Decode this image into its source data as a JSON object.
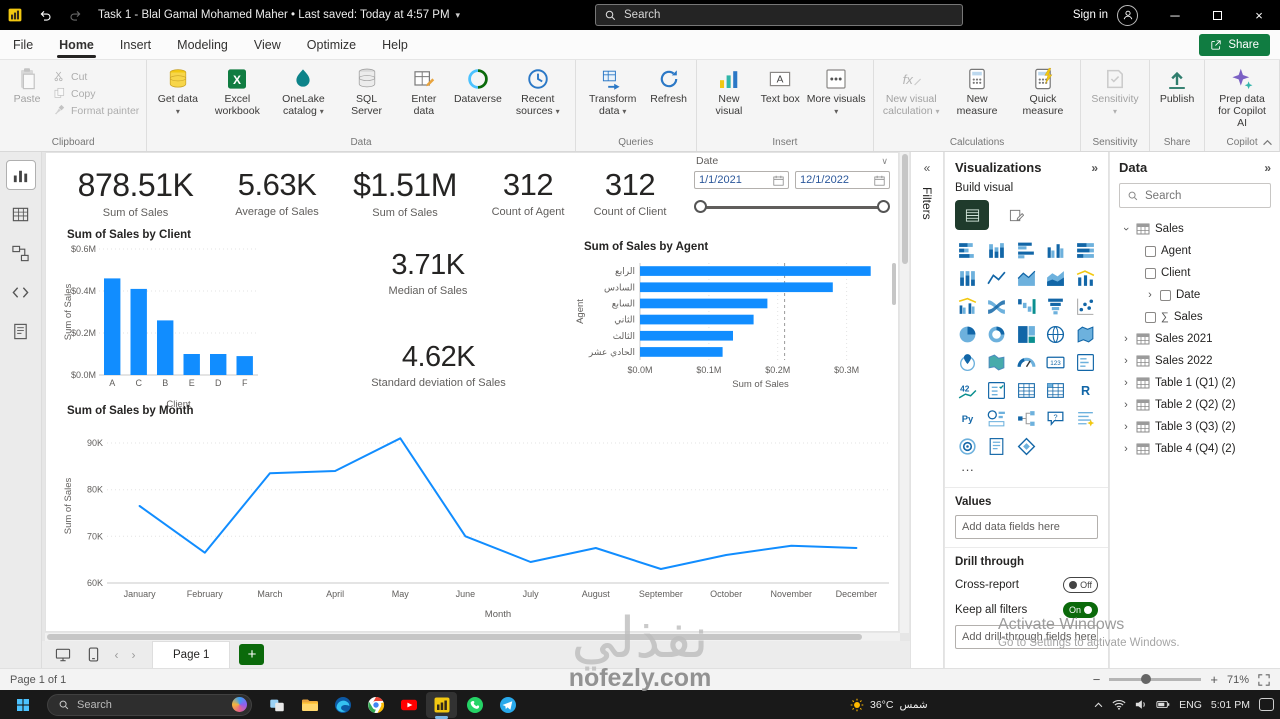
{
  "colors": {
    "accent_blue": "#118DFF",
    "share_green": "#107C41",
    "toggle_on_green": "#0B6A0B",
    "taskbar_black": "#191919"
  },
  "titlebar": {
    "title": "Task 1 - Blal Gamal Mohamed Maher  •  Last saved: Today at 4:57 PM",
    "search_placeholder": "Search",
    "sign_in": "Sign in"
  },
  "menu": {
    "items": [
      "File",
      "Home",
      "Insert",
      "Modeling",
      "View",
      "Optimize",
      "Help"
    ],
    "active_index": 1,
    "share_label": "Share"
  },
  "ribbon": {
    "groups": [
      {
        "label": "Clipboard",
        "layout": "clipboard",
        "items": [
          {
            "label": "Paste",
            "icon": "paste",
            "disabled": true,
            "big": true
          },
          {
            "label": "Cut",
            "icon": "cut",
            "disabled": true
          },
          {
            "label": "Copy",
            "icon": "copy",
            "disabled": true
          },
          {
            "label": "Format painter",
            "icon": "brush",
            "disabled": true
          }
        ]
      },
      {
        "label": "Data",
        "items": [
          {
            "label": "Get data",
            "icon": "getdata",
            "dropdown": true
          },
          {
            "label": "Excel workbook",
            "icon": "excel"
          },
          {
            "label": "OneLake catalog",
            "icon": "onelake",
            "dropdown": true
          },
          {
            "label": "SQL Server",
            "icon": "sql"
          },
          {
            "label": "Enter data",
            "icon": "enter"
          },
          {
            "label": "Dataverse",
            "icon": "dataverse"
          },
          {
            "label": "Recent sources",
            "icon": "recent",
            "dropdown": true
          }
        ]
      },
      {
        "label": "Queries",
        "items": [
          {
            "label": "Transform data",
            "icon": "transform",
            "dropdown": true
          },
          {
            "label": "Refresh",
            "icon": "refresh"
          }
        ]
      },
      {
        "label": "Insert",
        "items": [
          {
            "label": "New visual",
            "icon": "newvisual"
          },
          {
            "label": "Text box",
            "icon": "textbox"
          },
          {
            "label": "More visuals",
            "icon": "morevisuals",
            "dropdown": true
          }
        ]
      },
      {
        "label": "Calculations",
        "items": [
          {
            "label": "New visual calculation",
            "icon": "fx",
            "disabled": true,
            "dropdown": true
          },
          {
            "label": "New measure",
            "icon": "measure"
          },
          {
            "label": "Quick measure",
            "icon": "quickmeasure"
          }
        ]
      },
      {
        "label": "Sensitivity",
        "items": [
          {
            "label": "Sensitivity",
            "icon": "sensitivity",
            "disabled": true,
            "dropdown": true
          }
        ]
      },
      {
        "label": "Share",
        "items": [
          {
            "label": "Publish",
            "icon": "publish"
          }
        ]
      },
      {
        "label": "Copilot",
        "items": [
          {
            "label": "Prep data for Copilot AI",
            "icon": "copilot"
          }
        ]
      }
    ]
  },
  "view_strip": [
    "report-view",
    "table-view",
    "model-view",
    "dax-query-view",
    "tmdl-view"
  ],
  "canvas": {
    "cards": [
      {
        "value": "878.51K",
        "label": "Sum of Sales"
      },
      {
        "value": "5.63K",
        "label": "Average of Sales"
      },
      {
        "value": "$1.51M",
        "label": "Sum of Sales"
      },
      {
        "value": "312",
        "label": "Count of Agent"
      },
      {
        "value": "312",
        "label": "Count of Client"
      },
      {
        "value": "3.71K",
        "label": "Median of Sales"
      },
      {
        "value": "4.62K",
        "label": "Standard deviation of Sales"
      }
    ],
    "slicer": {
      "title": "Date",
      "start": "1/1/2021",
      "end": "12/1/2022"
    }
  },
  "chart_data": [
    {
      "id": "sales-by-client",
      "type": "bar",
      "title": "Sum of Sales by Client",
      "categories": [
        "A",
        "C",
        "B",
        "E",
        "D",
        "F"
      ],
      "values": [
        0.46,
        0.41,
        0.26,
        0.1,
        0.1,
        0.09
      ],
      "xlabel": "Client",
      "ylabel": "Sum of Sales",
      "ylim": [
        0,
        0.6
      ],
      "yticks": [
        "$0.0M",
        "$0.2M",
        "$0.4M",
        "$0.6M"
      ],
      "grid": true,
      "legend": "none"
    },
    {
      "id": "sales-by-agent",
      "type": "bar-horizontal",
      "title": "Sum of Sales by Agent",
      "categories": [
        "الرابع",
        "السادس",
        "السابع",
        "الثاني",
        "الثالث",
        "الحادي عشر"
      ],
      "values": [
        0.335,
        0.28,
        0.185,
        0.165,
        0.135,
        0.12
      ],
      "xlabel": "Sum of Sales",
      "ylabel": "Agent",
      "xlim": [
        0,
        0.35
      ],
      "xticks": [
        "$0.0M",
        "$0.1M",
        "$0.2M",
        "$0.3M"
      ],
      "reference_line": 0.21,
      "grid": true,
      "legend": "none"
    },
    {
      "id": "sales-by-month",
      "type": "line",
      "title": "Sum of Sales by Month",
      "categories": [
        "January",
        "February",
        "March",
        "April",
        "May",
        "June",
        "July",
        "August",
        "September",
        "October",
        "November",
        "December"
      ],
      "values": [
        76.5,
        66.5,
        83.5,
        84,
        91,
        70,
        64.5,
        67.5,
        63,
        66,
        68,
        67.5
      ],
      "unit": "K",
      "xlabel": "Month",
      "ylabel": "Sum of Sales",
      "ylim": [
        60,
        93
      ],
      "ytick_values": [
        60,
        70,
        80,
        90
      ],
      "yticks": [
        "60K",
        "70K",
        "80K",
        "90K"
      ],
      "grid": true,
      "legend": "none"
    }
  ],
  "filters_pane": {
    "title": "Filters"
  },
  "viz_pane": {
    "title": "Visualizations",
    "build_visual": "Build visual",
    "gallery": [
      "stacked-bar-chart",
      "stacked-column-chart",
      "clustered-bar-chart",
      "clustered-column-chart",
      "stacked-bar-100-chart",
      "stacked-column-100-chart",
      "line-chart",
      "area-chart",
      "stacked-area-chart",
      "line-and-stacked-column-chart",
      "line-and-clustered-column-chart",
      "ribbon-chart",
      "waterfall-chart",
      "funnel-chart",
      "scatter-chart",
      "pie-chart",
      "donut-chart",
      "treemap",
      "map",
      "filled-map",
      "azure-map",
      "shape-map",
      "gauge",
      "card",
      "multi-row-card",
      "kpi",
      "slicer",
      "table",
      "matrix",
      "r-script-visual",
      "python-visual",
      "key-influencers",
      "decomposition-tree",
      "qa-visual",
      "smart-narrative",
      "metrics",
      "paginated-report",
      "power-apps"
    ],
    "more_options_label": "···",
    "values_label": "Values",
    "add_fields": "Add data fields here",
    "drill_through": "Drill through",
    "cross_report": "Cross-report",
    "cross_report_state": "Off",
    "keep_filters": "Keep all filters",
    "keep_filters_state": "On",
    "add_drill": "Add drill-through fields here"
  },
  "data_pane": {
    "title": "Data",
    "search_placeholder": "Search",
    "tree": [
      {
        "name": "Sales",
        "type": "table",
        "expanded": true,
        "children": [
          {
            "name": "Agent",
            "checkbox": true
          },
          {
            "name": "Client",
            "checkbox": true
          },
          {
            "name": "Date",
            "checkbox": true,
            "chevron": true
          },
          {
            "name": "Sales",
            "checkbox": true,
            "sigma": true
          }
        ]
      },
      {
        "name": "Sales 2021",
        "type": "table"
      },
      {
        "name": "Sales 2022",
        "type": "table"
      },
      {
        "name": "Table 1 (Q1) (2)",
        "type": "table"
      },
      {
        "name": "Table 2 (Q2) (2)",
        "type": "table"
      },
      {
        "name": "Table 3 (Q3) (2)",
        "type": "table"
      },
      {
        "name": "Table 4 (Q4) (2)",
        "type": "table"
      }
    ]
  },
  "pages": {
    "current": "Page 1",
    "label": "Page 1 of 1",
    "zoom": "71%"
  },
  "watermark": {
    "arabic": "نفذلي",
    "site": "nofezly.com"
  },
  "activate": {
    "line1": "Activate Windows",
    "line2": "Go to Settings to activate Windows."
  },
  "taskbar": {
    "search_placeholder": "Search",
    "weather_temp": "36°C",
    "weather_desc": "شمس",
    "lang": "ENG",
    "time": "5:01 PM",
    "apps": [
      "task-view",
      "file-explorer",
      "edge",
      "chrome",
      "youtube",
      "power-bi",
      "whatsapp",
      "telegram"
    ]
  }
}
